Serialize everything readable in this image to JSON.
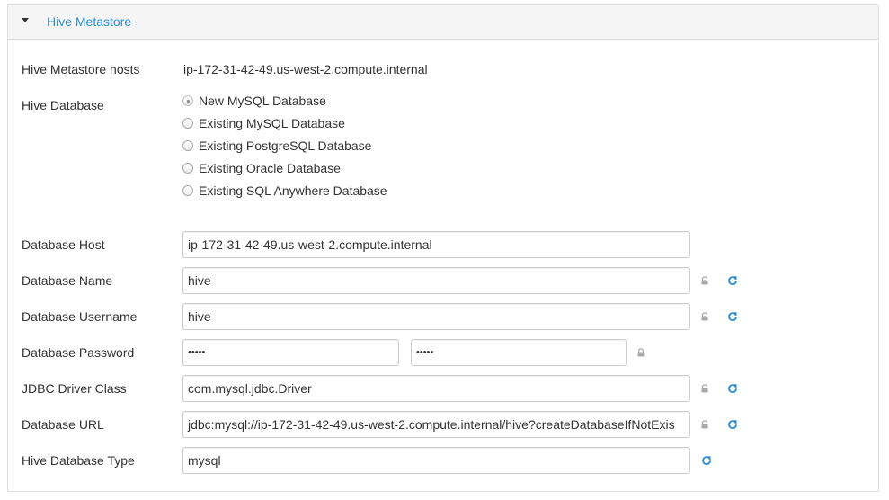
{
  "section": {
    "title": "Hive Metastore"
  },
  "fields": {
    "metastore_hosts": {
      "label": "Hive Metastore hosts",
      "value": "ip-172-31-42-49.us-west-2.compute.internal"
    },
    "hive_database": {
      "label": "Hive Database",
      "options": [
        "New MySQL Database",
        "Existing MySQL Database",
        "Existing PostgreSQL Database",
        "Existing Oracle Database",
        "Existing SQL Anywhere Database"
      ],
      "selected": "New MySQL Database"
    },
    "db_host": {
      "label": "Database Host",
      "value": "ip-172-31-42-49.us-west-2.compute.internal"
    },
    "db_name": {
      "label": "Database Name",
      "value": "hive"
    },
    "db_username": {
      "label": "Database Username",
      "value": "hive"
    },
    "db_password": {
      "label": "Database Password",
      "value": "•••••",
      "confirm_value": "•••••"
    },
    "jdbc_driver": {
      "label": "JDBC Driver Class",
      "value": "com.mysql.jdbc.Driver"
    },
    "db_url": {
      "label": "Database URL",
      "value": "jdbc:mysql://ip-172-31-42-49.us-west-2.compute.internal/hive?createDatabaseIfNotExis"
    },
    "hive_db_type": {
      "label": "Hive Database Type",
      "value": "mysql"
    }
  },
  "icons": {
    "caret": "caret-down-icon",
    "lock": "lock-icon",
    "refresh": "refresh-icon"
  },
  "colors": {
    "accent": "#2a8ed4",
    "lock": "#aaaaaa",
    "header_bg": "#f5f5f5",
    "border": "#cccccc"
  }
}
